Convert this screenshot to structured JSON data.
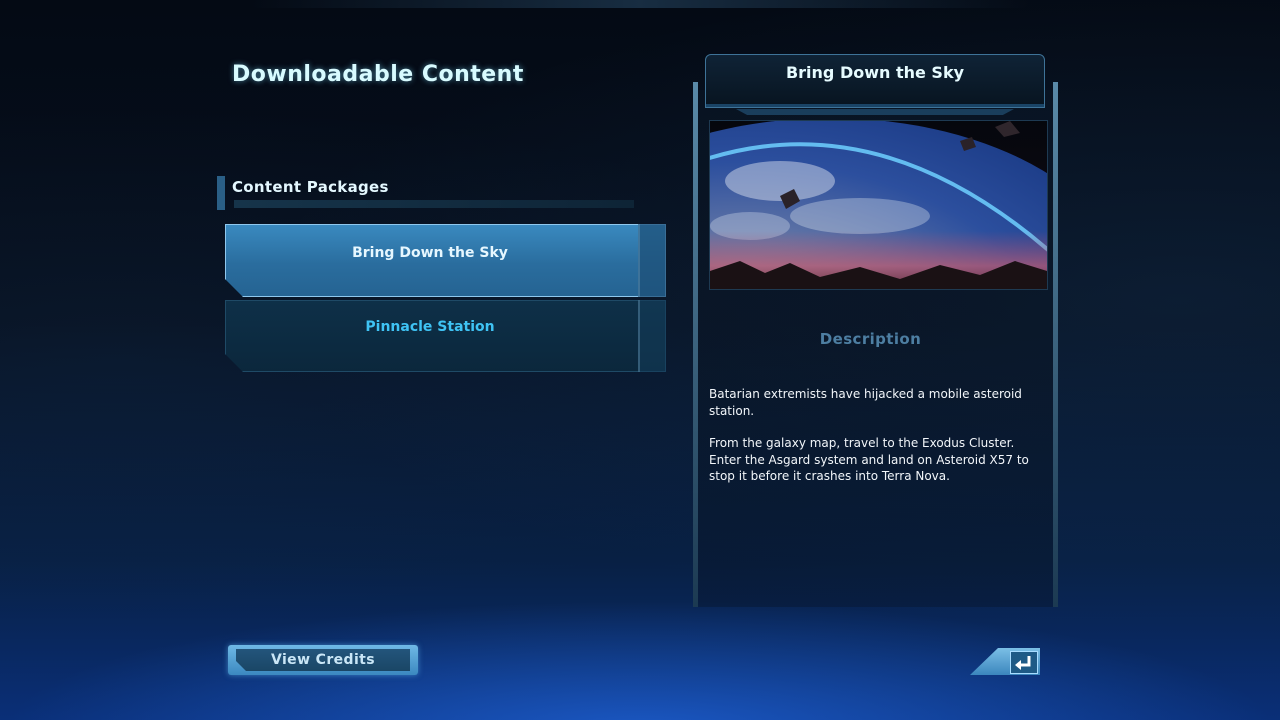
{
  "page": {
    "title": "Downloadable Content"
  },
  "packages": {
    "heading": "Content Packages",
    "items": [
      {
        "label": "Bring Down the Sky",
        "selected": true
      },
      {
        "label": "Pinnacle Station",
        "selected": false
      }
    ]
  },
  "detail": {
    "title": "Bring Down the Sky",
    "description_heading": "Description",
    "description": [
      "Batarian extremists have hijacked a mobile asteroid station.",
      "From the galaxy map, travel to the Exodus Cluster. Enter the Asgard system and land on Asteroid X57 to stop it before it crashes into Terra Nova."
    ]
  },
  "footer": {
    "credits_label": "View Credits",
    "back_icon": "back-arrow-icon"
  },
  "colors": {
    "accent": "#3fc3f4",
    "selected_fill": "#2a6d9e",
    "title_glow": "#d8fbff"
  }
}
